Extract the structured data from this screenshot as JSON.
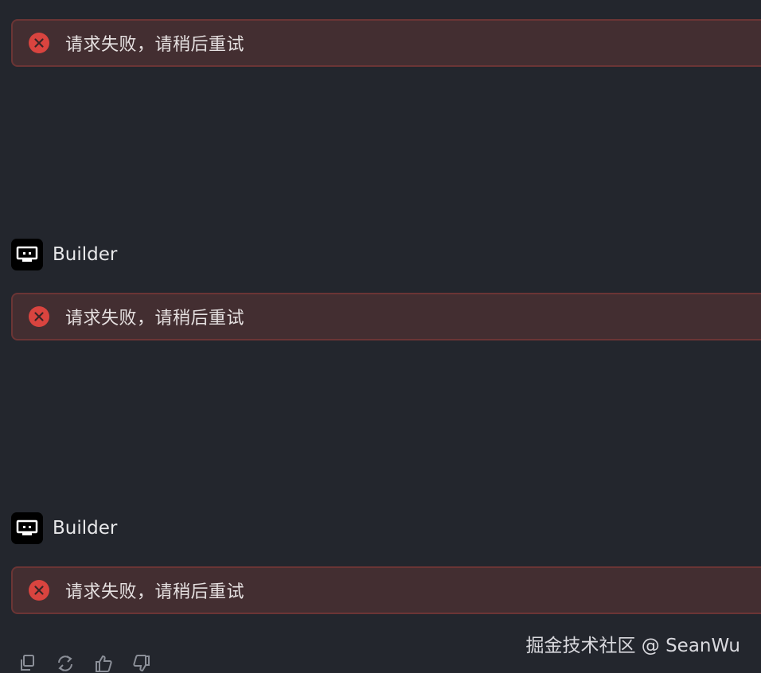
{
  "colors": {
    "background": "#23262d",
    "error_bg": "#432e31",
    "error_border": "#6b3535",
    "error_icon": "#d9443f",
    "text": "#e6e1e1"
  },
  "messages": [
    {
      "error": {
        "icon": "error-circle-icon",
        "text": "请求失败，请稍后重试"
      }
    },
    {
      "sender": {
        "avatar": "bot-avatar-icon",
        "name": "Builder"
      },
      "error": {
        "icon": "error-circle-icon",
        "text": "请求失败，请稍后重试"
      }
    },
    {
      "sender": {
        "avatar": "bot-avatar-icon",
        "name": "Builder"
      },
      "error": {
        "icon": "error-circle-icon",
        "text": "请求失败，请稍后重试"
      }
    }
  ],
  "actions": [
    "copy-icon",
    "regenerate-icon",
    "thumbs-up-icon",
    "thumbs-down-icon"
  ],
  "watermark": "掘金技术社区 @ SeanWu"
}
